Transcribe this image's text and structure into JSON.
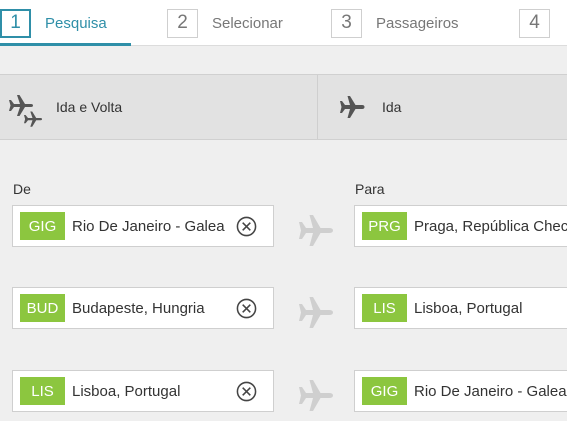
{
  "steps": [
    {
      "number": "1",
      "label": "Pesquisa",
      "active": true
    },
    {
      "number": "2",
      "label": "Selecionar",
      "active": false
    },
    {
      "number": "3",
      "label": "Passageiros",
      "active": false
    },
    {
      "number": "4",
      "label": "",
      "active": false
    }
  ],
  "trip_types": [
    {
      "label": "Ida e Volta",
      "icon": "round-trip-plane-icon"
    },
    {
      "label": "Ida",
      "icon": "one-way-plane-icon"
    }
  ],
  "labels": {
    "from": "De",
    "to": "Para"
  },
  "routes": [
    {
      "from": {
        "code": "GIG",
        "city": "Rio De Janeiro - Galea"
      },
      "to": {
        "code": "PRG",
        "city": "Praga, República Chec"
      }
    },
    {
      "from": {
        "code": "BUD",
        "city": "Budapeste, Hungria"
      },
      "to": {
        "code": "LIS",
        "city": "Lisboa, Portugal"
      }
    },
    {
      "from": {
        "code": "LIS",
        "city": "Lisboa, Portugal"
      },
      "to": {
        "code": "GIG",
        "city": "Rio De Janeiro - Galea"
      }
    }
  ],
  "colors": {
    "accent": "#2f8fa8",
    "code_badge": "#8cc63f",
    "background": "#efefef"
  }
}
